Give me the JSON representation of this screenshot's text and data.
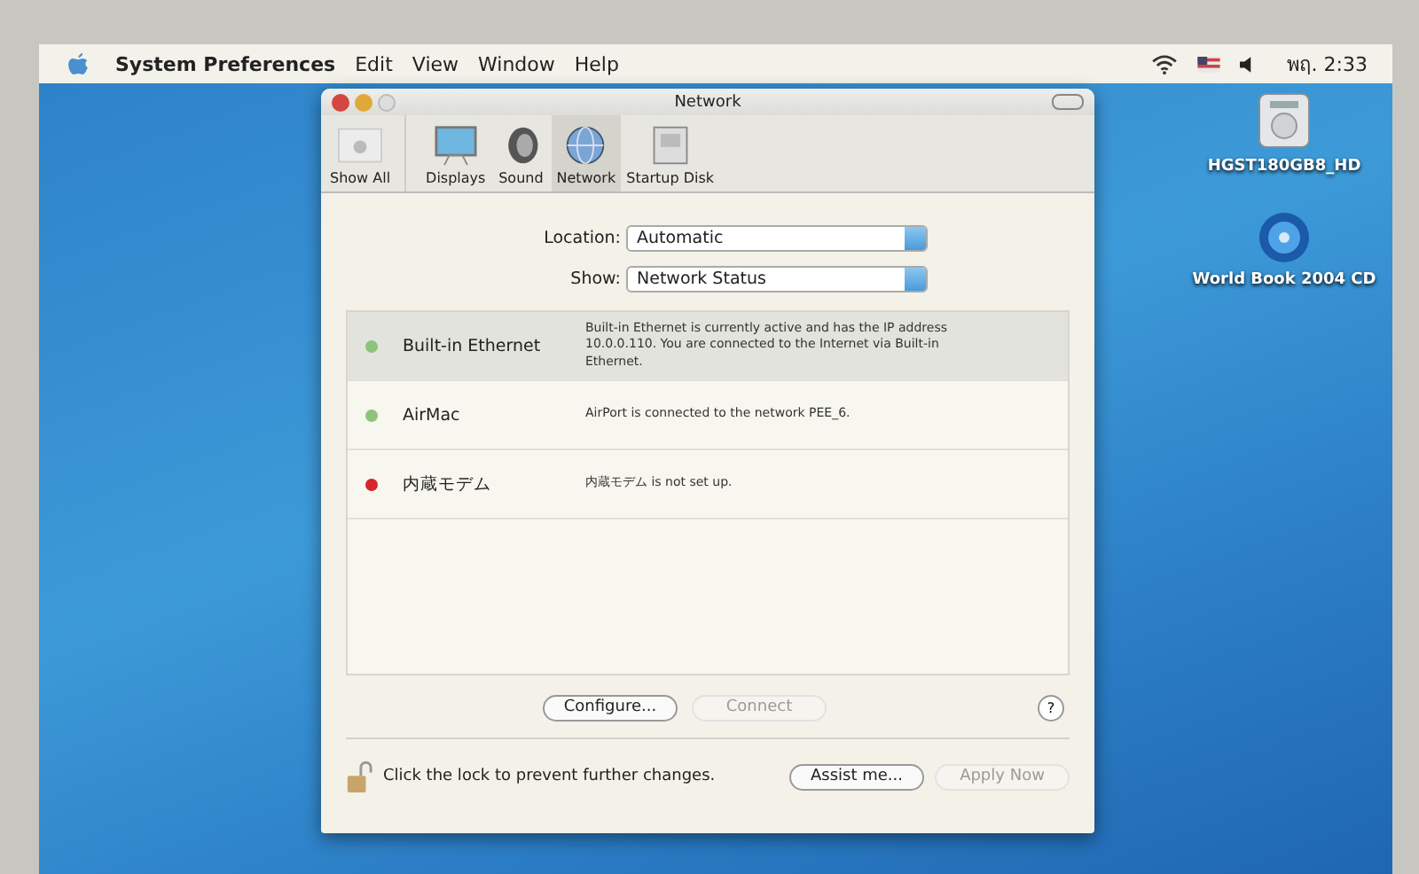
{
  "menu_bar": {
    "app": "System Preferences",
    "menus": [
      "Edit",
      "View",
      "Window",
      "Help"
    ],
    "clock": "พฤ. 2:33"
  },
  "window": {
    "title": "Network",
    "toolbar": [
      {
        "label": "Show All",
        "kind": "showall",
        "selected": false
      },
      {
        "label": "Displays",
        "kind": "displays",
        "selected": false
      },
      {
        "label": "Sound",
        "kind": "sound",
        "selected": false
      },
      {
        "label": "Network",
        "kind": "network",
        "selected": true
      },
      {
        "label": "Startup Disk",
        "kind": "disk",
        "selected": false
      }
    ],
    "location": {
      "label": "Location:",
      "value": "Automatic"
    },
    "show": {
      "label": "Show:",
      "value": "Network Status"
    },
    "services": [
      {
        "name": "Built-in Ethernet",
        "status": "Built-in Ethernet is currently active and has the IP address 10.0.0.110. You are connected to the Internet via Built-in Ethernet.",
        "color": "#8cc47a",
        "selected": true
      },
      {
        "name": "AirMac",
        "status": "AirPort is connected to the network PEE_6.",
        "color": "#8cc47a",
        "selected": false
      },
      {
        "name": "内蔵モデム",
        "status": "内蔵モデム is not set up.",
        "color": "#d8242c",
        "selected": false
      }
    ],
    "buttons": [
      {
        "label": "Configure...",
        "disabled": false
      },
      {
        "label": "Connect",
        "disabled": true
      }
    ],
    "help_button": "?",
    "lock_text": "Click the lock to prevent further changes.",
    "footer_buttons": [
      {
        "label": "Assist me...",
        "disabled": false
      },
      {
        "label": "Apply Now",
        "disabled": true
      }
    ]
  },
  "desktop_icons": [
    {
      "label": "HGST180GB8_HD",
      "kind": "disk"
    },
    {
      "label": "World Book 2004 CD",
      "kind": "cd"
    }
  ]
}
